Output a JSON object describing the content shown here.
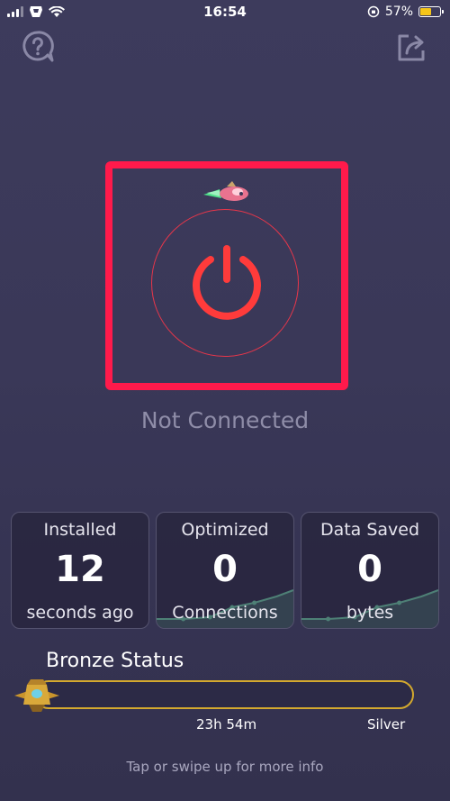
{
  "status_bar": {
    "time": "16:54",
    "battery_percent": "57%",
    "battery_level": 0.57
  },
  "connection": {
    "status": "Not Connected"
  },
  "stats": [
    {
      "title": "Installed",
      "value": "12",
      "subtitle": "seconds ago"
    },
    {
      "title": "Optimized",
      "value": "0",
      "subtitle": "Connections"
    },
    {
      "title": "Data Saved",
      "value": "0",
      "subtitle": "bytes"
    }
  ],
  "tier": {
    "title": "Bronze Status",
    "time_remaining": "23h 54m",
    "next_tier": "Silver",
    "progress": 0.0
  },
  "hint": "Tap or swipe up for more info",
  "colors": {
    "accent_red": "#ff1a4b",
    "power_red": "#ff3b3b",
    "gold": "#d4a92e",
    "background": "#3a3858"
  },
  "icons": [
    "help-icon",
    "share-icon",
    "power-icon",
    "rocket-icon",
    "ship-icon",
    "wifi-icon",
    "battery-icon"
  ]
}
